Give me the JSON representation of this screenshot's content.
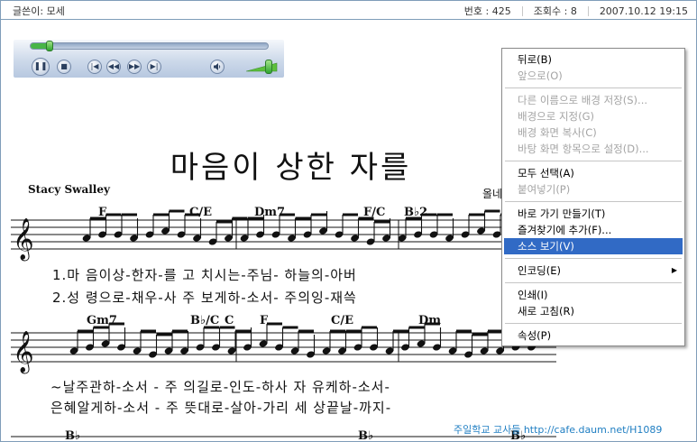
{
  "post": {
    "author_label": "글쓴이:",
    "author": "모세",
    "number_label": "번호 :",
    "number": "425",
    "views_label": "조회수 :",
    "views": "8",
    "datetime": "2007.10.12 19:15"
  },
  "player": {
    "progress": 0.08,
    "volume": 0.95,
    "buttons": [
      "pause-icon",
      "stop-icon",
      "previous-icon",
      "rewind-icon",
      "fast-forward-icon",
      "next-icon",
      "speaker-icon"
    ]
  },
  "sheet": {
    "title": "마음이 상한 자를",
    "composer": "Stacy Swalley",
    "arranger": "올네이",
    "chords_row1": [
      "F",
      "C/E",
      "Dm7",
      "F/C",
      "B♭2"
    ],
    "chords_row2": [
      "Gm7",
      "B♭/C",
      "C",
      "F",
      "C/E",
      "Dm"
    ],
    "lyrics_row1": [
      "1.마 음이상-한자-를 고 치시는-주님-  하늘의-아버",
      "2.성 령으로-채우-사 주 보게하-소서-  주의잉-재쓱"
    ],
    "lyrics_row2": [
      "~날주관하-소서 - 주 의길로-인도-하사 자 유케하-소서-",
      "은혜알게하-소서 - 주 뜻대로-살아-가리 세 상끝날-까지-"
    ],
    "lower_chords": [
      "B♭",
      "B♭",
      "B♭"
    ]
  },
  "watermark": "주일학교 교사들 http://cafe.daum.net/H1089",
  "context_menu": {
    "items": [
      {
        "label": "뒤로(B)",
        "enabled": true
      },
      {
        "label": "앞으로(O)",
        "enabled": false
      },
      {
        "label": "다른 이름으로 배경 저장(S)...",
        "enabled": false
      },
      {
        "label": "배경으로 지정(G)",
        "enabled": false
      },
      {
        "label": "배경 화면 복사(C)",
        "enabled": false
      },
      {
        "label": "바탕 화면 항목으로 설정(D)...",
        "enabled": false
      },
      {
        "label": "모두 선택(A)",
        "enabled": true
      },
      {
        "label": "붙여넣기(P)",
        "enabled": false
      },
      {
        "label": "바로 가기 만들기(T)",
        "enabled": true
      },
      {
        "label": "즐겨찾기에 추가(F)...",
        "enabled": true
      },
      {
        "label": "소스 보기(V)",
        "enabled": true,
        "highlighted": true
      },
      {
        "label": "인코딩(E)",
        "enabled": true,
        "submenu": true
      },
      {
        "label": "인쇄(I)",
        "enabled": true
      },
      {
        "label": "새로 고침(R)",
        "enabled": true
      },
      {
        "label": "속성(P)",
        "enabled": true
      }
    ]
  },
  "colors": {
    "highlight": "#316ac5",
    "frame": "#7f9db9",
    "watermark": "#1f7ec2"
  }
}
